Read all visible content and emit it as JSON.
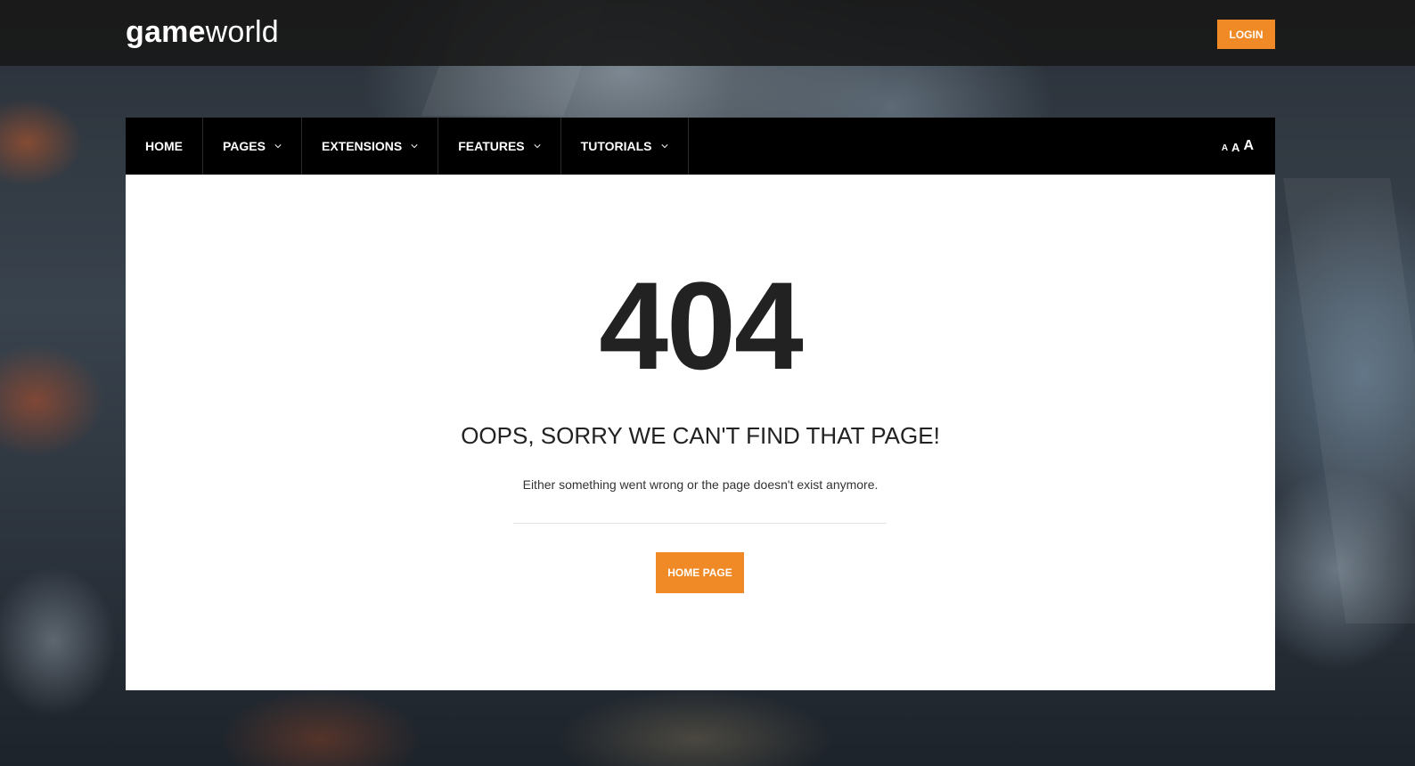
{
  "header": {
    "logo_bold": "game",
    "logo_light": "world",
    "login_label": "LOGIN"
  },
  "nav": {
    "items": [
      {
        "label": "HOME",
        "has_dropdown": false
      },
      {
        "label": "PAGES",
        "has_dropdown": true
      },
      {
        "label": "EXTENSIONS",
        "has_dropdown": true
      },
      {
        "label": "FEATURES",
        "has_dropdown": true
      },
      {
        "label": "TUTORIALS",
        "has_dropdown": true
      }
    ],
    "font_size_controls": [
      "A",
      "A",
      "A"
    ]
  },
  "error": {
    "code": "404",
    "title": "OOPS, SORRY WE CAN'T FIND THAT PAGE!",
    "description": "Either something went wrong or the page doesn't exist anymore.",
    "home_button_label": "HOME PAGE"
  },
  "colors": {
    "accent": "#f08a26",
    "topbar": "#181818",
    "nav_bg": "#000000",
    "content_bg": "#ffffff",
    "text_dark": "#222222"
  },
  "icons": {
    "dropdown": "chevron-down-icon"
  }
}
